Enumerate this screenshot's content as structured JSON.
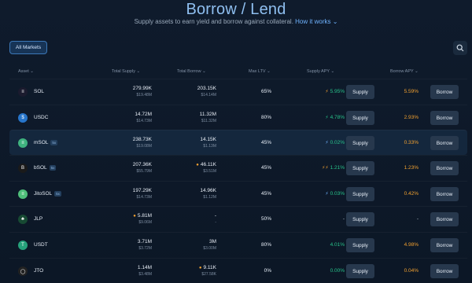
{
  "header": {
    "title": "Borrow / Lend",
    "subtitle": "Supply assets to earn yield and borrow against collateral.",
    "how_it_works": "How it works ⌄"
  },
  "toolbar": {
    "all_markets_label": "All Markets"
  },
  "columns": {
    "asset": "Asset ⌄",
    "total_supply": "Total Supply ⌄",
    "total_borrow": "Total Borrow ⌄",
    "max_ltv": "Max LTV ⌄",
    "supply_apy": "Supply APY ⌄",
    "borrow_apy": "Borrow APY ⌄"
  },
  "rows": [
    {
      "asset": "SOL",
      "badge": "",
      "supply": "279.99K",
      "supply_usd": "$19.48M",
      "borrow": "203.15K",
      "borrow_usd": "$14.14M",
      "ltv": "65%",
      "supply_apy": "5.95%",
      "borrow_apy": "5.59%",
      "supply_btn": "Supply",
      "borrow_btn": "Borrow"
    },
    {
      "asset": "USDC",
      "badge": "",
      "supply": "14.72M",
      "supply_usd": "$14.73M",
      "borrow": "11.32M",
      "borrow_usd": "$11.32M",
      "ltv": "80%",
      "supply_apy": "4.78%",
      "borrow_apy": "2.93%",
      "supply_btn": "Supply",
      "borrow_btn": "Borrow"
    },
    {
      "asset": "mSOL",
      "badge": "5x",
      "supply": "238.73K",
      "supply_usd": "$19.08M",
      "borrow": "14.15K",
      "borrow_usd": "$1.13M",
      "ltv": "45%",
      "supply_apy": "0.02%",
      "borrow_apy": "0.33%",
      "supply_btn": "Supply",
      "borrow_btn": "Borrow"
    },
    {
      "asset": "bSOL",
      "badge": "5x",
      "supply": "207.36K",
      "supply_usd": "$55.79M",
      "borrow": "46.11K",
      "borrow_usd": "$3.51M",
      "ltv": "45%",
      "supply_apy": "1.21%",
      "borrow_apy": "1.23%",
      "supply_btn": "Supply",
      "borrow_btn": "Borrow"
    },
    {
      "asset": "JitoSOL",
      "badge": "5x",
      "supply": "197.29K",
      "supply_usd": "$14.73M",
      "borrow": "14.96K",
      "borrow_usd": "$1.12M",
      "ltv": "45%",
      "supply_apy": "0.03%",
      "borrow_apy": "0.42%",
      "supply_btn": "Supply",
      "borrow_btn": "Borrow"
    },
    {
      "asset": "JLP",
      "badge": "",
      "supply": "5.81M",
      "supply_usd": "$9.06M",
      "borrow": "-",
      "borrow_usd": "-",
      "ltv": "50%",
      "supply_apy": "-",
      "borrow_apy": "-",
      "supply_btn": "Supply",
      "borrow_btn": "Borrow"
    },
    {
      "asset": "USDT",
      "badge": "",
      "supply": "3.71M",
      "supply_usd": "$3.72M",
      "borrow": "3M",
      "borrow_usd": "$3.00M",
      "ltv": "80%",
      "supply_apy": "4.01%",
      "borrow_apy": "4.98%",
      "supply_btn": "Supply",
      "borrow_btn": "Borrow"
    },
    {
      "asset": "JTO",
      "badge": "",
      "supply": "1.14M",
      "supply_usd": "$3.48M",
      "borrow": "9.11K",
      "borrow_usd": "$27.58K",
      "ltv": "0%",
      "supply_apy": "0.00%",
      "borrow_apy": "0.04%",
      "supply_btn": "Supply",
      "borrow_btn": "Borrow"
    }
  ],
  "colors": {
    "accent": "#6fb3ff",
    "supply_apy": "#27c28a",
    "borrow_apy": "#f0a030",
    "button": "#27384d"
  }
}
